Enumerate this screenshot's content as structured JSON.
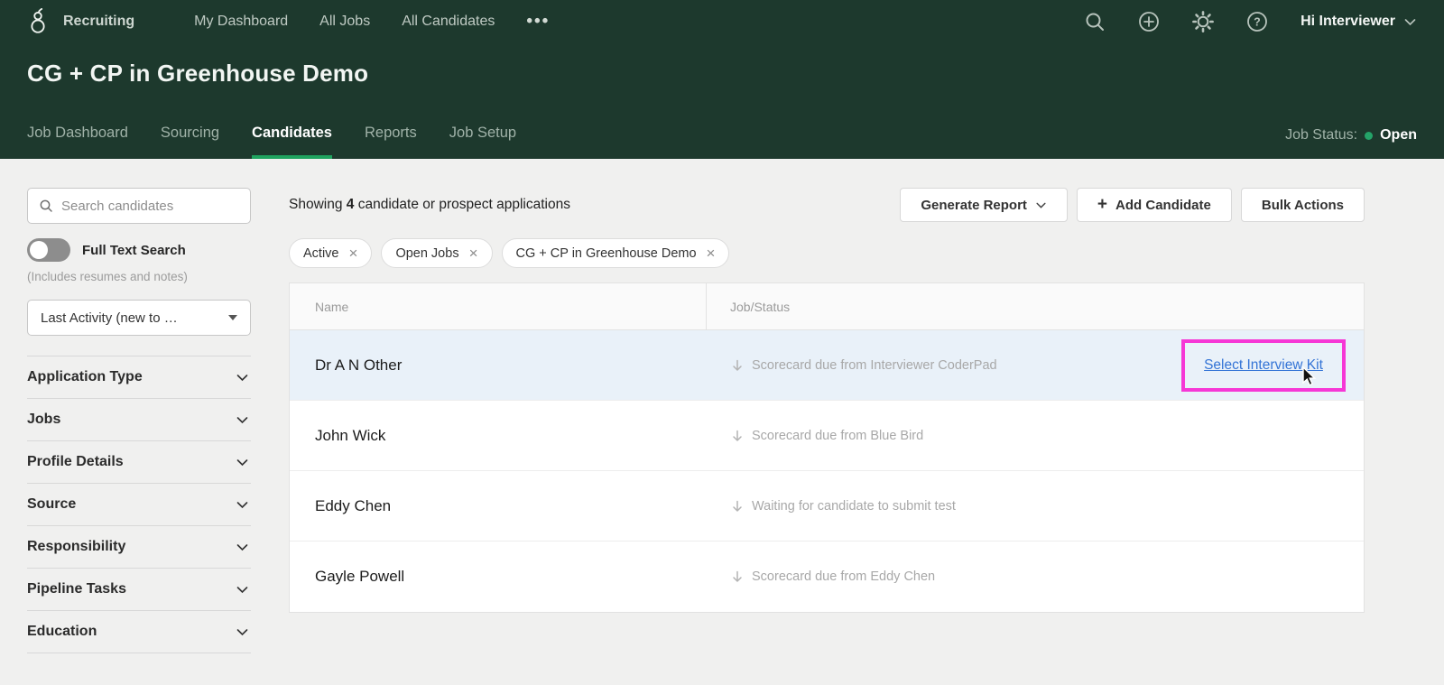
{
  "topnav": {
    "product": "Recruiting",
    "items": [
      "My Dashboard",
      "All Jobs",
      "All Candidates"
    ],
    "more_label": "•••",
    "user": "Hi Interviewer"
  },
  "header": {
    "title": "CG + CP in Greenhouse Demo",
    "tabs": [
      "Job Dashboard",
      "Sourcing",
      "Candidates",
      "Reports",
      "Job Setup"
    ],
    "active_tab": "Candidates",
    "job_status_label": "Job Status:",
    "job_status_value": "Open"
  },
  "sidebar": {
    "search_placeholder": "Search candidates",
    "toggle_label": "Full Text Search",
    "toggle_note": "(Includes resumes and notes)",
    "sort_value": "Last Activity (new to …",
    "filters": [
      "Application Type",
      "Jobs",
      "Profile Details",
      "Source",
      "Responsibility",
      "Pipeline Tasks",
      "Education"
    ]
  },
  "main": {
    "summary_prefix": "Showing",
    "summary_count": "4",
    "summary_suffix": "candidate or prospect applications",
    "chips": [
      "Active",
      "Open Jobs",
      "CG + CP in Greenhouse Demo"
    ],
    "buttons": {
      "generate_report": "Generate Report",
      "add_candidate": "Add Candidate",
      "bulk_actions": "Bulk Actions"
    },
    "table": {
      "columns": [
        "Name",
        "Job/Status"
      ],
      "rows": [
        {
          "name": "Dr A N Other",
          "status": "Scorecard due from Interviewer CoderPad",
          "action": "Select Interview Kit",
          "highlighted": true
        },
        {
          "name": "John Wick",
          "status": "Scorecard due from Blue Bird",
          "highlighted": false
        },
        {
          "name": "Eddy Chen",
          "status": "Waiting for candidate to submit test",
          "highlighted": false
        },
        {
          "name": "Gayle Powell",
          "status": "Scorecard due from Eddy Chen",
          "highlighted": false
        }
      ]
    }
  },
  "colors": {
    "header_green": "#1d392d",
    "accent_green": "#1fa35f",
    "status_dot_green": "#24a368",
    "link_blue": "#3474d6",
    "highlight_magenta": "#f637d6",
    "row_highlight_blue": "#e9f1f9"
  }
}
